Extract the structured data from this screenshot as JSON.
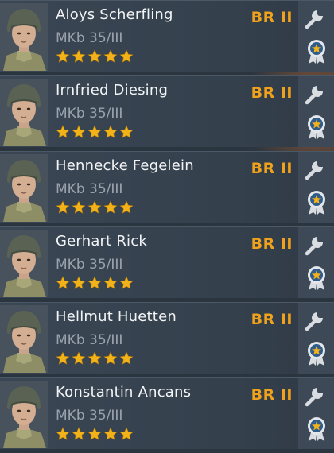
{
  "colors": {
    "accent_br": "#f0a21c",
    "star_gold": "#f2b21a",
    "name_text": "#f2f4f6",
    "weapon_text": "#9aa3ad"
  },
  "icons": {
    "upgrade": "wrench-icon",
    "award": "medal-icon",
    "rating": "star-icon"
  },
  "soldiers": [
    {
      "name": "Aloys Scherfling",
      "weapon": "MKb 35/III",
      "br": "BR II",
      "stars": 5
    },
    {
      "name": "Irnfried Diesing",
      "weapon": "MKb 35/III",
      "br": "BR II",
      "stars": 5
    },
    {
      "name": "Hennecke Fegelein",
      "weapon": "MKb 35/III",
      "br": "BR II",
      "stars": 5
    },
    {
      "name": "Gerhart Rick",
      "weapon": "MKb 35/III",
      "br": "BR II",
      "stars": 5
    },
    {
      "name": "Hellmut Huetten",
      "weapon": "MKb 35/III",
      "br": "BR II",
      "stars": 5
    },
    {
      "name": "Konstantin Ancans",
      "weapon": "MKb 35/III",
      "br": "BR II",
      "stars": 5
    }
  ]
}
